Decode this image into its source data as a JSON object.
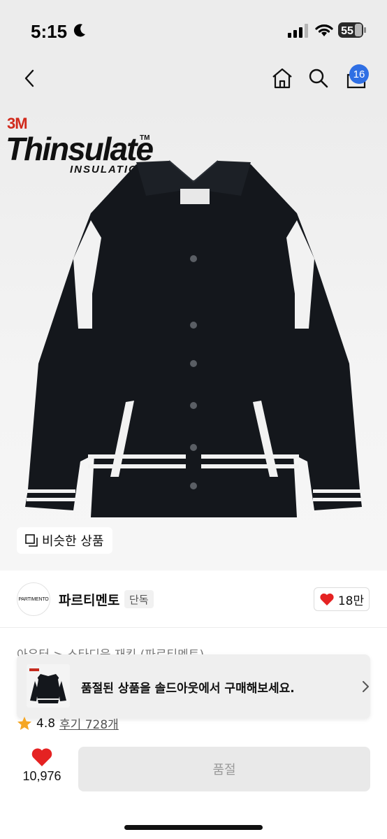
{
  "status_bar": {
    "time": "5:15",
    "battery": "55"
  },
  "nav": {
    "cart_count": "16"
  },
  "hero": {
    "brand_3m": "3M",
    "brand_name": "Thinsulate",
    "brand_tm": "TM",
    "brand_sub": "INSULATION",
    "similar_label": "비슷한 상품"
  },
  "seller": {
    "logo_text": "PARTIMENTO",
    "name": "파르티멘토",
    "tag": "단독",
    "likes": "18만"
  },
  "breadcrumb": "아우터 > 스타디움 재킷 (파르티멘토)",
  "banner": {
    "text": "품절된 상품을 솔드아웃에서 구매해보세요."
  },
  "rating": {
    "score": "4.8",
    "reviews": "후기 728개"
  },
  "bottom": {
    "wish_count": "10,976",
    "buy_label": "품절"
  },
  "colors": {
    "accent": "#2f6fe4",
    "heart": "#e52222",
    "star": "#f5a623"
  }
}
